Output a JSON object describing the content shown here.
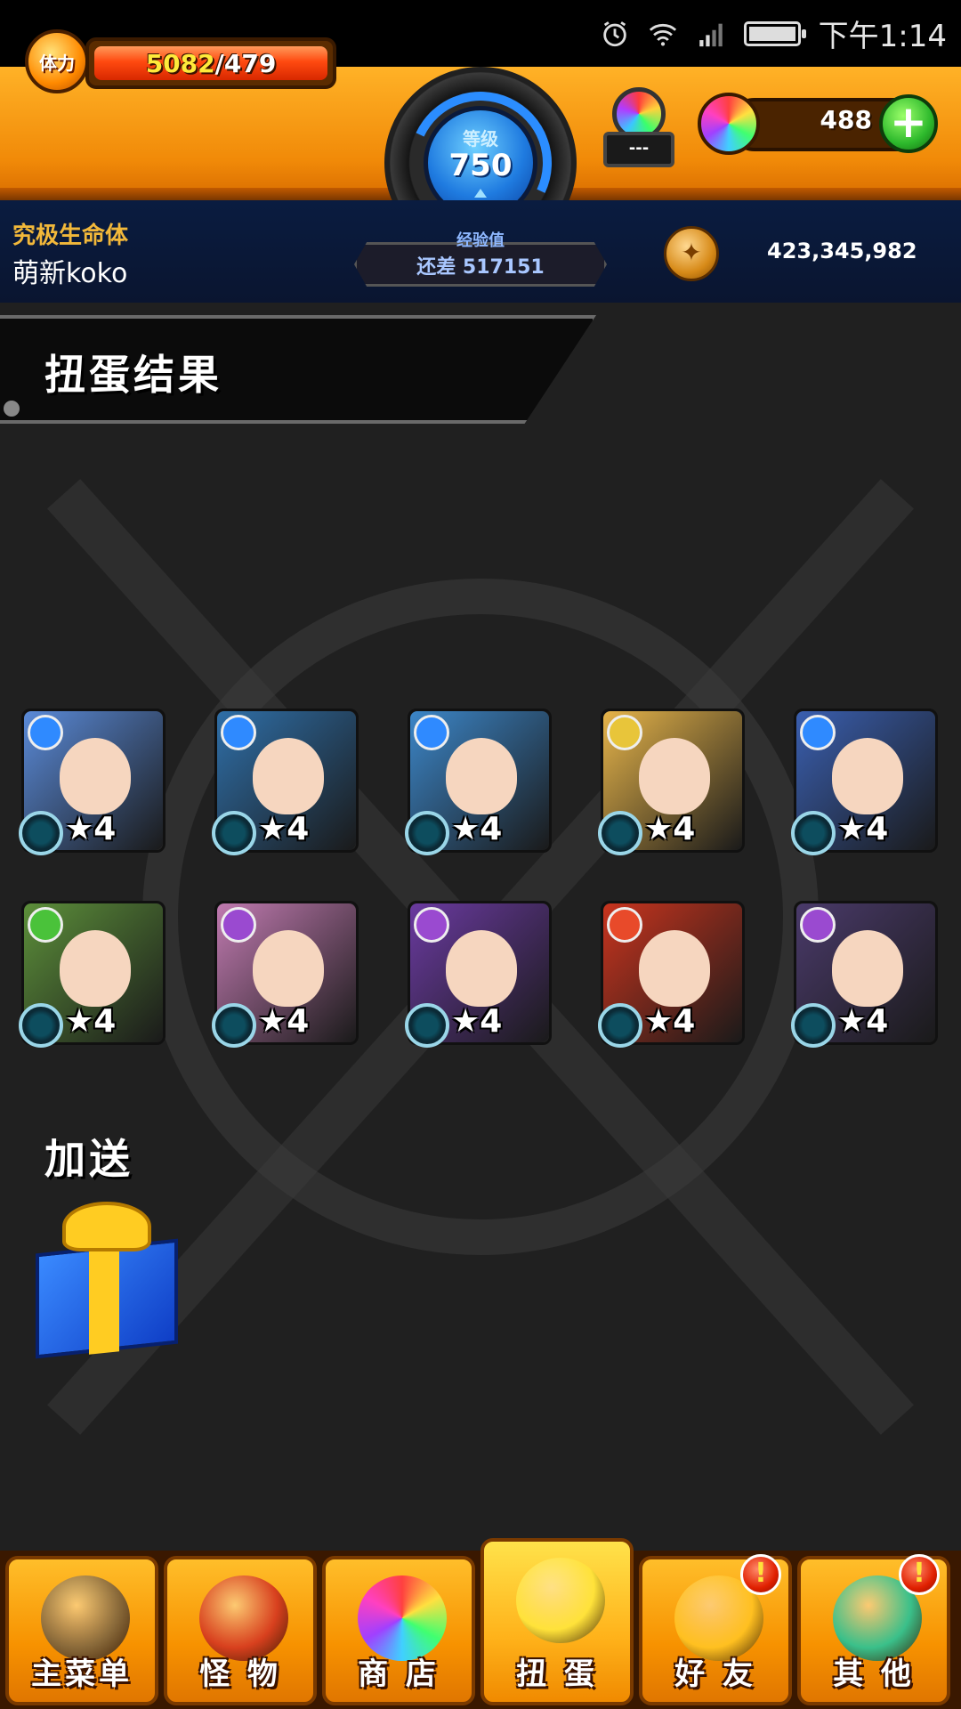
{
  "status_bar": {
    "time": "下午1:14"
  },
  "header": {
    "stamina_label": "体力",
    "stamina_current": "5082",
    "stamina_max": "/479",
    "level_label": "等级",
    "level_value": "750",
    "potion_value": "---",
    "orb_count": "488",
    "rank_title": "究极生命体",
    "username": "萌新koko",
    "exp_label": "经验值",
    "exp_remaining": "还差 517151",
    "gold": "423,345,982"
  },
  "result": {
    "title": "扭蛋结果"
  },
  "monsters": [
    {
      "rarity": "★4",
      "element": "water",
      "bg": "#5a8ad8"
    },
    {
      "rarity": "★4",
      "element": "water",
      "bg": "#2f6fa8"
    },
    {
      "rarity": "★4",
      "element": "water",
      "bg": "#3c86c8"
    },
    {
      "rarity": "★4",
      "element": "light",
      "bg": "#e6b44a"
    },
    {
      "rarity": "★4",
      "element": "water",
      "bg": "#3a5fb0"
    },
    {
      "rarity": "★4",
      "element": "wood",
      "bg": "#5c8f3a"
    },
    {
      "rarity": "★4",
      "element": "dark",
      "bg": "#c07ab0"
    },
    {
      "rarity": "★4",
      "element": "dark",
      "bg": "#6a3aa0"
    },
    {
      "rarity": "★4",
      "element": "fire",
      "bg": "#c8341e"
    },
    {
      "rarity": "★4",
      "element": "dark",
      "bg": "#4a3a6a"
    }
  ],
  "element_colors": {
    "water": "#2f8aff",
    "light": "#e8c53a",
    "wood": "#4ac23a",
    "dark": "#9a4ad0",
    "fire": "#e84a2a"
  },
  "bonus": {
    "label": "加送"
  },
  "nav": [
    {
      "label": "主菜单",
      "icon": "gate-icon",
      "alert": ""
    },
    {
      "label": "怪 物",
      "icon": "monster-icon",
      "alert": ""
    },
    {
      "label": "商 店",
      "icon": "orb-icon",
      "alert": ""
    },
    {
      "label": "扭 蛋",
      "icon": "egg-icon",
      "alert": ""
    },
    {
      "label": "好 友",
      "icon": "friends-icon",
      "alert": "!"
    },
    {
      "label": "其 他",
      "icon": "other-icon",
      "alert": "!"
    }
  ]
}
